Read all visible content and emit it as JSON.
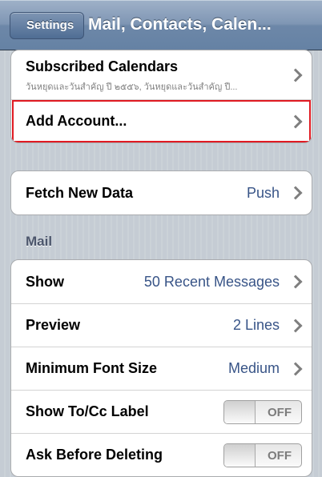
{
  "navbar": {
    "back_label": "Settings",
    "title": "Mail, Contacts, Calen..."
  },
  "accounts": {
    "subscribed_label": "Subscribed Calendars",
    "subscribed_detail": "วันหยุดและวันสำคัญ ปี ๒๕๕๖, วันหยุดและวันสำคัญ ปี...",
    "add_account_label": "Add Account..."
  },
  "fetch": {
    "label": "Fetch New Data",
    "value": "Push"
  },
  "mail": {
    "header": "Mail",
    "show_label": "Show",
    "show_value": "50 Recent Messages",
    "preview_label": "Preview",
    "preview_value": "2 Lines",
    "font_label": "Minimum Font Size",
    "font_value": "Medium",
    "tocc_label": "Show To/Cc Label",
    "tocc_toggle": "OFF",
    "ask_label": "Ask Before Deleting",
    "ask_toggle": "OFF"
  },
  "colors": {
    "highlight": "#e01a22",
    "value_text": "#385487"
  }
}
